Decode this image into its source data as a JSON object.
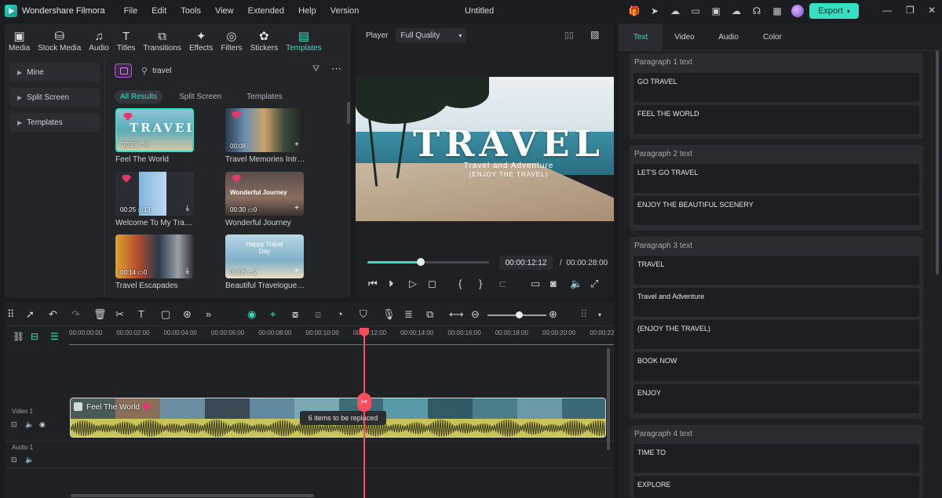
{
  "app": {
    "name": "Wondershare Filmora",
    "menu": [
      "File",
      "Edit",
      "Tools",
      "View",
      "Extended",
      "Help",
      "Version"
    ],
    "window_title": "Untitled",
    "export_label": "Export",
    "accent_color": "#35e0c0"
  },
  "media_tools": [
    {
      "label": "Media",
      "icon": "media-icon"
    },
    {
      "label": "Stock Media",
      "icon": "stock-media-icon"
    },
    {
      "label": "Audio",
      "icon": "audio-icon"
    },
    {
      "label": "Titles",
      "icon": "titles-icon"
    },
    {
      "label": "Transitions",
      "icon": "transitions-icon"
    },
    {
      "label": "Effects",
      "icon": "effects-icon"
    },
    {
      "label": "Filters",
      "icon": "filters-icon"
    },
    {
      "label": "Stickers",
      "icon": "stickers-icon"
    },
    {
      "label": "Templates",
      "icon": "templates-icon",
      "active": true
    }
  ],
  "sidebar": {
    "items": [
      "Mine",
      "Split Screen",
      "Templates"
    ]
  },
  "search": {
    "value": "travel"
  },
  "filters": [
    "All Results",
    "Split Screen",
    "Templates"
  ],
  "templates": [
    {
      "title": "Feel The World",
      "duration": "00:28",
      "count": "6"
    },
    {
      "title": "Travel Memories Intro ...",
      "duration": "00:08",
      "count": ""
    },
    {
      "title": "Welcome To My Travel...",
      "duration": "00:25",
      "count": "13"
    },
    {
      "title": "Wonderful Journey",
      "duration": "00:30",
      "count": "0"
    },
    {
      "title": "Travel Escapades",
      "duration": "00:14",
      "count": "0"
    },
    {
      "title": "Beautiful Travelogue I...",
      "duration": "00:06",
      "count": "2"
    }
  ],
  "thumb_text": {
    "t1": "TRAVEL",
    "t4": "Wonderful Journey",
    "t6": "Happy Travel Day"
  },
  "player": {
    "label": "Player",
    "quality": "Full Quality",
    "preview_title": "TRAVEL",
    "preview_sub": "Travel and Adventure",
    "preview_sub2": "(ENJOY THE TRAVEL)",
    "current_time": "00:00:12:12",
    "total_time": "00:00:28:00",
    "separator": "/",
    "progress": 0.44
  },
  "timeline": {
    "ticks": [
      "00:00:00:00",
      "00:00:02:00",
      "00:00:04:00",
      "00:00:06:00",
      "00:00:08:00",
      "00:00:10:00",
      "00:00:12:00",
      "00:00:14:00",
      "00:00:16:00",
      "00:00:18:00",
      "00:00:20:00",
      "00:00:22"
    ],
    "video_track": "Video 1",
    "audio_track": "Audio 1",
    "clip_title": "Feel The World",
    "replace_tooltip": "6 items to be replaced"
  },
  "right_panel": {
    "tabs": [
      "Text",
      "Video",
      "Audio",
      "Color"
    ],
    "paragraphs": [
      {
        "title": "Paragraph 1 text",
        "fields": [
          "GO TRAVEL",
          "FEEL THE WORLD"
        ]
      },
      {
        "title": "Paragraph 2 text",
        "fields": [
          "LET'S GO TRAVEL",
          "ENJOY THE  BEAUTIFUL SCENERY"
        ]
      },
      {
        "title": "Paragraph 3 text",
        "fields": [
          "TRAVEL",
          "Travel and Adventure",
          "(ENJOY THE TRAVEL)",
          "BOOK NOW",
          "ENJOY"
        ]
      },
      {
        "title": "Paragraph 4 text",
        "fields": [
          "TIME TO",
          "EXPLORE"
        ]
      }
    ]
  }
}
